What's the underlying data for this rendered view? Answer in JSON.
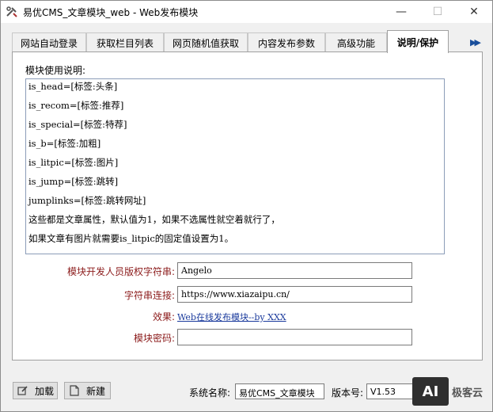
{
  "window": {
    "title": "易优CMS_文章模块_web - Web发布模块",
    "minimize": "—",
    "maximize": "☐",
    "close": "✕"
  },
  "tabs": [
    {
      "label": "网站自动登录"
    },
    {
      "label": "获取栏目列表"
    },
    {
      "label": "网页随机值获取"
    },
    {
      "label": "内容发布参数"
    },
    {
      "label": "高级功能"
    },
    {
      "label": "说明/保护"
    }
  ],
  "tab_scroll_icon": "double-chevron-right-icon",
  "panel": {
    "usage_label": "模块使用说明:",
    "usage_lines": [
      "is_head=[标签:头条]",
      "is_recom=[标签:推荐]",
      "is_special=[标签:特荐]",
      "is_b=[标签:加粗]",
      "is_litpic=[标签:图片]",
      "is_jump=[标签:跳转]",
      "jumplinks=[标签:跳转网址]",
      "这些都是文章属性，默认值为1，如果不选属性就空着就行了，",
      "如果文章有图片就需要is_litpic的固定值设置为1。"
    ],
    "author_label": "模块开发人员版权字符串:",
    "author_value": "Angelo",
    "link_label": "字符串连接:",
    "link_value": "https://www.xiazaipu.cn/",
    "effect_label": "效果:",
    "effect_link": "Web在线发布模块--by XXX",
    "password_label": "模块密码:",
    "password_value": ""
  },
  "footer": {
    "load_label": "加载",
    "new_label": "新建",
    "system_name_label": "系统名称:",
    "system_name_value": "易优CMS_文章模块",
    "version_label": "版本号:",
    "version_value": "V1.53"
  },
  "watermark": {
    "badge": "AI",
    "text": "极客云"
  }
}
